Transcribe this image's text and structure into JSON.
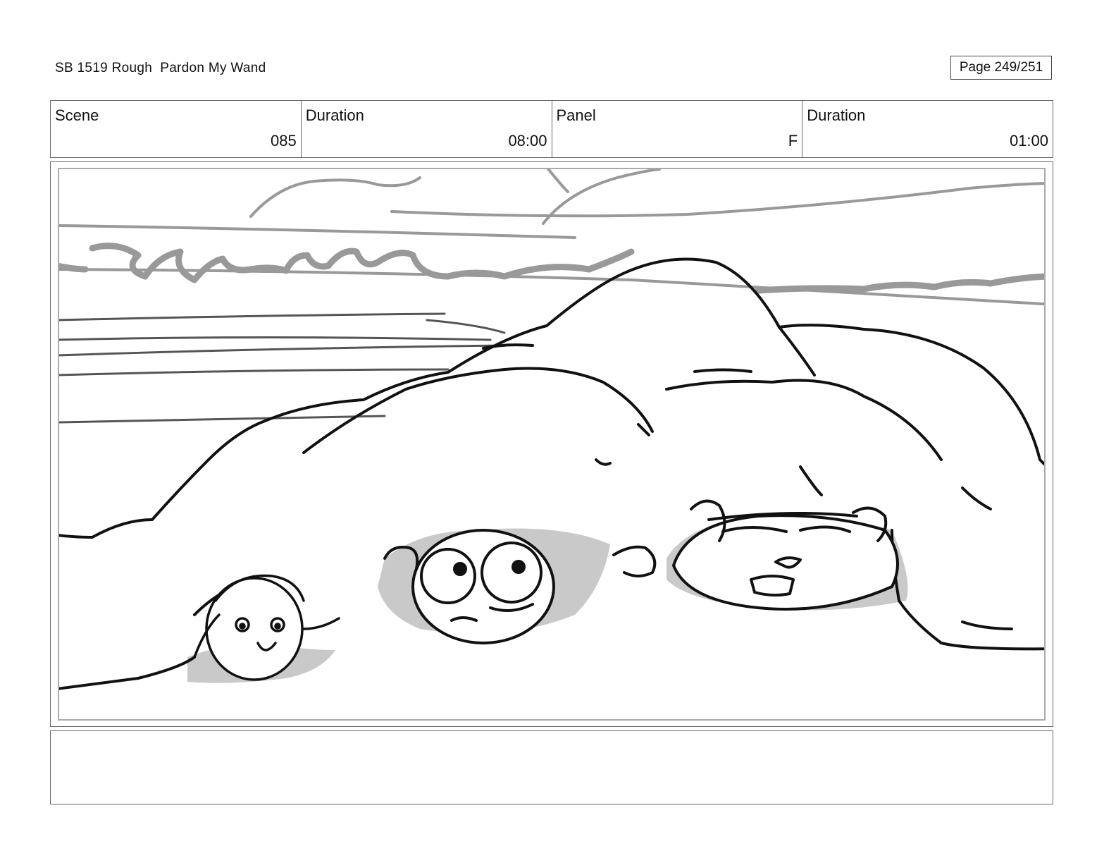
{
  "header": {
    "doc_title": "SB 1519 Rough  Pardon My Wand",
    "page_label": "Page 249/251"
  },
  "info": [
    {
      "label": "Scene",
      "value": "085"
    },
    {
      "label": "Duration",
      "value": "08:00"
    },
    {
      "label": "Panel",
      "value": "F"
    },
    {
      "label": "Duration",
      "value": "01:00"
    }
  ],
  "notes": {
    "text": ""
  }
}
